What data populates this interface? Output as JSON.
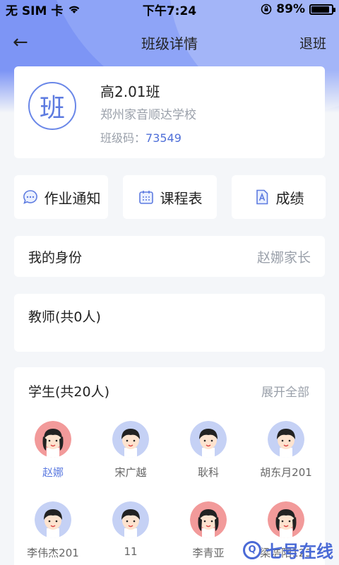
{
  "status_bar": {
    "carrier": "无 SIM 卡",
    "wifi_icon": "wifi-icon",
    "time": "下午7:24",
    "rotation_lock_icon": "rotation-lock-icon",
    "battery_percent": "89%",
    "battery_level": 0.89
  },
  "nav": {
    "back_icon": "←",
    "title": "班级详情",
    "action": "退班"
  },
  "class_info": {
    "avatar_char": "班",
    "name": "高2.01班",
    "school": "郑州家音顺达学校",
    "code_label": "班级码：",
    "code_value": "73549"
  },
  "tiles": [
    {
      "label": "作业通知",
      "icon": "chat-bubble-icon"
    },
    {
      "label": "课程表",
      "icon": "calendar-icon"
    },
    {
      "label": "成绩",
      "icon": "document-a-icon"
    }
  ],
  "identity": {
    "label": "我的身份",
    "value": "赵娜家长"
  },
  "teachers": {
    "title": "教师(共0人)"
  },
  "students": {
    "title": "学生(共20人)",
    "expand": "展开全部",
    "items": [
      {
        "name": "赵娜",
        "gender": "girl",
        "highlight": true
      },
      {
        "name": "宋广越",
        "gender": "boy"
      },
      {
        "name": "耿科",
        "gender": "boy"
      },
      {
        "name": "胡东月201",
        "gender": "boy"
      },
      {
        "name": "李伟杰201",
        "gender": "boy"
      },
      {
        "name": "11",
        "gender": "boy"
      },
      {
        "name": "李青亚",
        "gender": "girl"
      },
      {
        "name": "梁浩阳123",
        "gender": "girl"
      }
    ]
  },
  "watermark": {
    "q": "Q",
    "text": "七号在线"
  },
  "colors": {
    "accent": "#5d7be0",
    "hero": "#7d95f5",
    "background": "#f4f6f9"
  }
}
